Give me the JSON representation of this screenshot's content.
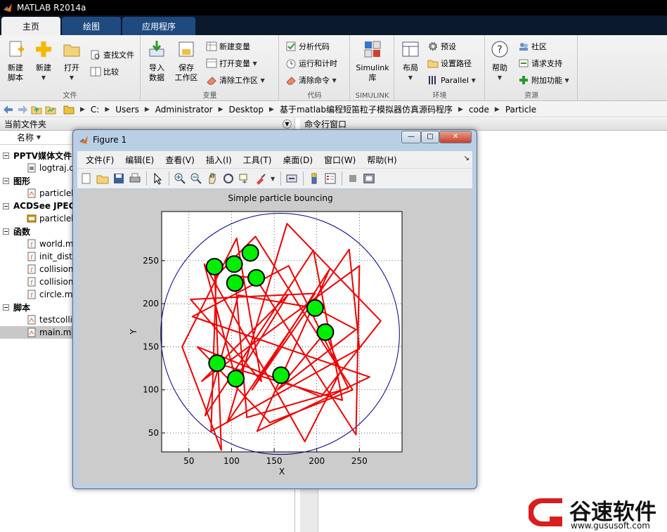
{
  "app": {
    "title": "MATLAB R2014a"
  },
  "tabs": [
    {
      "label": "主页",
      "active": true
    },
    {
      "label": "绘图",
      "active": false
    },
    {
      "label": "应用程序",
      "active": false
    }
  ],
  "ribbon": {
    "file": {
      "label": "文件",
      "new_script": "新建\n脚本",
      "new": "新建",
      "open": "打开",
      "find_files": "查找文件",
      "compare": "比较"
    },
    "variable": {
      "label": "变量",
      "import": "导入\n数据",
      "save_ws": "保存\n工作区",
      "new_var": "新建变量",
      "open_var": "打开变量",
      "clear_ws": "清除工作区"
    },
    "code": {
      "label": "代码",
      "analyze": "分析代码",
      "run_time": "运行和计时",
      "clear_cmd": "清除命令"
    },
    "simulink": {
      "label": "SIMULINK",
      "lib": "Simulink\n库"
    },
    "env": {
      "label": "环境",
      "layout": "布局",
      "prefs": "预设",
      "set_path": "设置路径",
      "parallel": "Parallel"
    },
    "resources": {
      "label": "资源",
      "help": "帮助",
      "community": "社区",
      "support": "请求支持",
      "addons": "附加功能"
    }
  },
  "address": {
    "crumbs": [
      "C:",
      "Users",
      "Administrator",
      "Desktop",
      "基于matlab编程短笛粒子模拟器仿真源码程序",
      "code",
      "Particle"
    ]
  },
  "left_panel": {
    "title": "当前文件夹",
    "column": "名称",
    "sections": [
      {
        "label": "PPTV媒体文件(",
        "files": [
          "logtraj.c"
        ]
      },
      {
        "label": "图形",
        "files": [
          "particleb"
        ]
      },
      {
        "label": "ACDSee JPEG",
        "files": [
          "particleb"
        ]
      },
      {
        "label": "函数",
        "files": [
          "world.m",
          "init_distr",
          "collision",
          "collision",
          "circle.m"
        ]
      },
      {
        "label": "脚本",
        "files": [
          "testcolli",
          "main.m"
        ]
      }
    ]
  },
  "right_panel": {
    "title": "命令行窗口"
  },
  "figure": {
    "title": "Figure 1",
    "buttons": {
      "minimize": "—",
      "maximize": "□",
      "close": "✕"
    },
    "menu": [
      "文件(F)",
      "编辑(E)",
      "查看(V)",
      "插入(I)",
      "工具(T)",
      "桌面(D)",
      "窗口(W)",
      "帮助(H)"
    ],
    "toolbar_icons": [
      "new-figure-icon",
      "open-icon",
      "save-icon",
      "print-icon",
      "pointer-icon",
      "zoom-in-icon",
      "zoom-out-icon",
      "pan-icon",
      "rotate-icon",
      "data-cursor-icon",
      "brush-icon",
      "link-icon",
      "colorbar-icon",
      "legend-icon",
      "hide-tools-icon",
      "dock-tools-icon"
    ]
  },
  "chart_data": {
    "type": "scatter",
    "title": "Simple particle bouncing",
    "xlabel": "X",
    "ylabel": "Y",
    "xlim": [
      18,
      300
    ],
    "ylim": [
      28,
      307
    ],
    "xticks": [
      50,
      100,
      150,
      200,
      250
    ],
    "yticks": [
      50,
      100,
      150,
      200,
      250
    ],
    "grid": "dotted",
    "colors": {
      "particle": "#00ee00",
      "trajectory": "#ee0000",
      "boundary": "#000080"
    },
    "boundary_circle": {
      "cx": 157,
      "cy": 165,
      "r": 140
    },
    "particles": [
      {
        "x": 80,
        "y": 243
      },
      {
        "x": 103,
        "y": 246
      },
      {
        "x": 122,
        "y": 259
      },
      {
        "x": 104,
        "y": 224
      },
      {
        "x": 129,
        "y": 230
      },
      {
        "x": 198,
        "y": 195
      },
      {
        "x": 210,
        "y": 167
      },
      {
        "x": 83,
        "y": 131
      },
      {
        "x": 105,
        "y": 113
      },
      {
        "x": 158,
        "y": 117
      }
    ],
    "trajectory": [
      [
        80,
        243
      ],
      [
        88,
        30
      ],
      [
        42,
        150
      ],
      [
        106,
        276
      ],
      [
        135,
        110
      ],
      [
        52,
        205
      ],
      [
        198,
        212
      ],
      [
        95,
        62
      ],
      [
        165,
        293
      ],
      [
        275,
        180
      ],
      [
        205,
        92
      ],
      [
        60,
        150
      ],
      [
        145,
        62
      ],
      [
        242,
        100
      ],
      [
        128,
        278
      ],
      [
        82,
        232
      ],
      [
        76,
        52
      ],
      [
        250,
        148
      ],
      [
        238,
        263
      ],
      [
        124,
        100
      ],
      [
        215,
        240
      ],
      [
        130,
        52
      ],
      [
        262,
        115
      ],
      [
        54,
        185
      ],
      [
        167,
        244
      ],
      [
        237,
        102
      ],
      [
        118,
        68
      ],
      [
        104,
        232
      ],
      [
        128,
        230
      ],
      [
        246,
        48
      ],
      [
        250,
        244
      ],
      [
        65,
        110
      ],
      [
        166,
        210
      ],
      [
        105,
        113
      ],
      [
        68,
        246
      ],
      [
        186,
        40
      ],
      [
        228,
        122
      ],
      [
        210,
        167
      ],
      [
        154,
        100
      ],
      [
        246,
        170
      ],
      [
        198,
        195
      ],
      [
        108,
        210
      ],
      [
        69,
        70
      ],
      [
        196,
        262
      ],
      [
        230,
        88
      ],
      [
        82,
        131
      ]
    ]
  },
  "watermark": {
    "text": "谷速软件",
    "url": "www.gususoft.com"
  }
}
